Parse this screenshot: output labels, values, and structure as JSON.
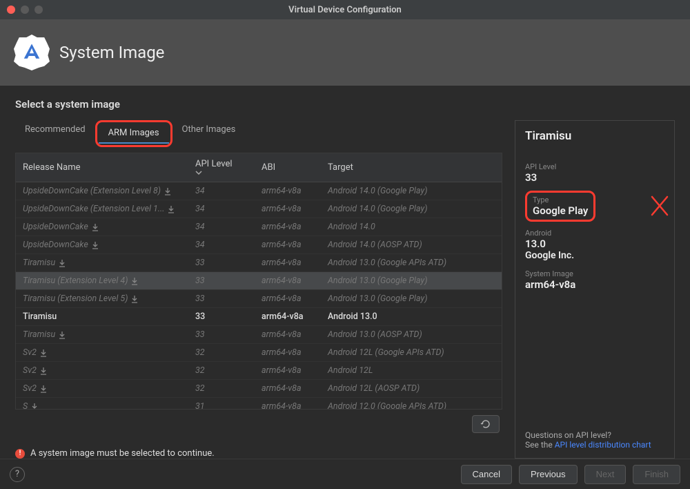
{
  "window": {
    "title": "Virtual Device Configuration"
  },
  "header": {
    "page_title": "System Image"
  },
  "section_title": "Select a system image",
  "tabs": {
    "recommended": "Recommended",
    "arm": "ARM Images",
    "other": "Other Images"
  },
  "columns": {
    "release": "Release Name",
    "api": "API Level",
    "abi": "ABI",
    "target": "Target"
  },
  "rows": [
    {
      "name": "UpsideDownCake (Extension Level 8)",
      "dl": true,
      "api": "34",
      "abi": "arm64-v8a",
      "target": "Android 14.0 (Google Play)"
    },
    {
      "name": "UpsideDownCake (Extension Level 1...",
      "dl": true,
      "api": "34",
      "abi": "arm64-v8a",
      "target": "Android 14.0 (Google Play)"
    },
    {
      "name": "UpsideDownCake",
      "dl": true,
      "api": "34",
      "abi": "arm64-v8a",
      "target": "Android 14.0"
    },
    {
      "name": "UpsideDownCake",
      "dl": true,
      "api": "34",
      "abi": "arm64-v8a",
      "target": "Android 14.0 (AOSP ATD)"
    },
    {
      "name": "Tiramisu",
      "dl": true,
      "api": "33",
      "abi": "arm64-v8a",
      "target": "Android 13.0 (Google APIs ATD)"
    },
    {
      "name": "Tiramisu (Extension Level 4)",
      "dl": true,
      "api": "33",
      "abi": "arm64-v8a",
      "target": "Android 13.0 (Google Play)",
      "highlight": true
    },
    {
      "name": "Tiramisu (Extension Level 5)",
      "dl": true,
      "api": "33",
      "abi": "arm64-v8a",
      "target": "Android 13.0 (Google Play)"
    },
    {
      "name": "Tiramisu",
      "dl": false,
      "api": "33",
      "abi": "arm64-v8a",
      "target": "Android 13.0",
      "active": true
    },
    {
      "name": "Tiramisu",
      "dl": true,
      "api": "33",
      "abi": "arm64-v8a",
      "target": "Android 13.0 (AOSP ATD)"
    },
    {
      "name": "Sv2",
      "dl": true,
      "api": "32",
      "abi": "arm64-v8a",
      "target": "Android 12L (Google APIs ATD)"
    },
    {
      "name": "Sv2",
      "dl": true,
      "api": "32",
      "abi": "arm64-v8a",
      "target": "Android 12L"
    },
    {
      "name": "Sv2",
      "dl": true,
      "api": "32",
      "abi": "arm64-v8a",
      "target": "Android 12L (AOSP ATD)"
    },
    {
      "name": "S",
      "dl": true,
      "api": "31",
      "abi": "arm64-v8a",
      "target": "Android 12.0 (Google APIs ATD)"
    }
  ],
  "details": {
    "title": "Tiramisu",
    "api_label": "API Level",
    "api_value": "33",
    "type_label": "Type",
    "type_value": "Google Play",
    "android_label": "Android",
    "android_version": "13.0",
    "android_vendor": "Google Inc.",
    "sysimg_label": "System Image",
    "sysimg_value": "arm64-v8a",
    "question": "Questions on API level?",
    "see_the": "See the ",
    "link": "API level distribution chart"
  },
  "error": "A system image must be selected to continue.",
  "footer": {
    "cancel": "Cancel",
    "previous": "Previous",
    "next": "Next",
    "finish": "Finish"
  }
}
